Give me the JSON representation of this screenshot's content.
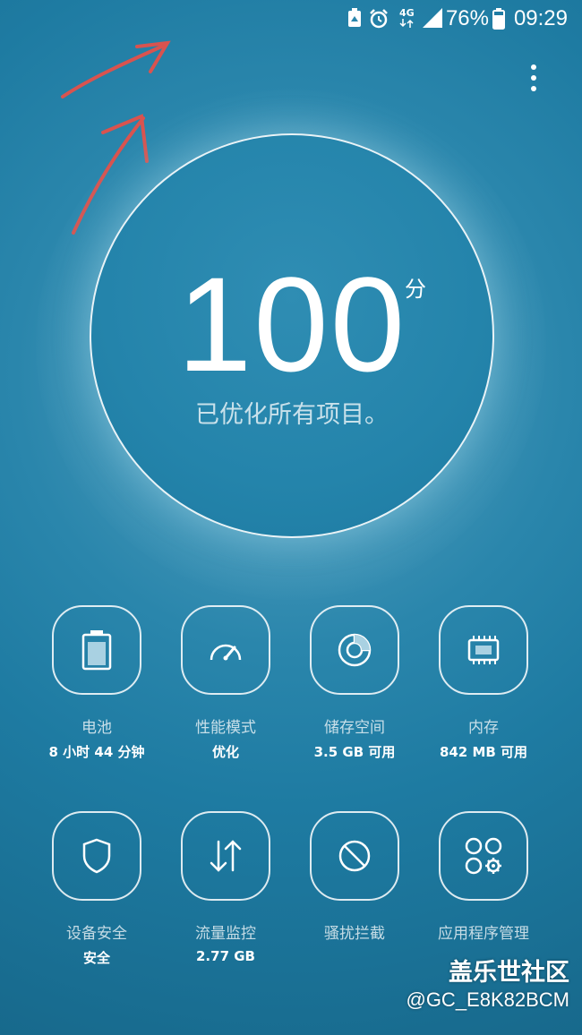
{
  "statusbar": {
    "network": "4G",
    "battery_percent": "76%",
    "time": "09:29",
    "icons": [
      "recycle-icon",
      "alarm-icon",
      "signal-icon",
      "battery-icon"
    ]
  },
  "score": {
    "value": "100",
    "unit": "分",
    "status": "已优化所有项目。"
  },
  "tiles": [
    {
      "label": "电池",
      "value": "8 小时 44 分钟",
      "icon": "battery-icon"
    },
    {
      "label": "性能模式",
      "value": "优化",
      "icon": "speedometer-icon"
    },
    {
      "label": "储存空间",
      "value": "3.5 GB 可用",
      "icon": "storage-donut-icon"
    },
    {
      "label": "内存",
      "value": "842 MB 可用",
      "icon": "memory-chip-icon"
    },
    {
      "label": "设备安全",
      "value": "安全",
      "icon": "shield-icon"
    },
    {
      "label": "流量监控",
      "value": "2.77 GB",
      "icon": "data-transfer-icon"
    },
    {
      "label": "骚扰拦截",
      "value": "",
      "icon": "block-icon"
    },
    {
      "label": "应用程序管理",
      "value": "",
      "icon": "apps-settings-icon"
    }
  ],
  "watermark": {
    "site": "盖乐世社区",
    "user": "@GC_E8K82BCM"
  },
  "colors": {
    "background": "#2280a8",
    "annotation_arrow": "#d9534f"
  }
}
